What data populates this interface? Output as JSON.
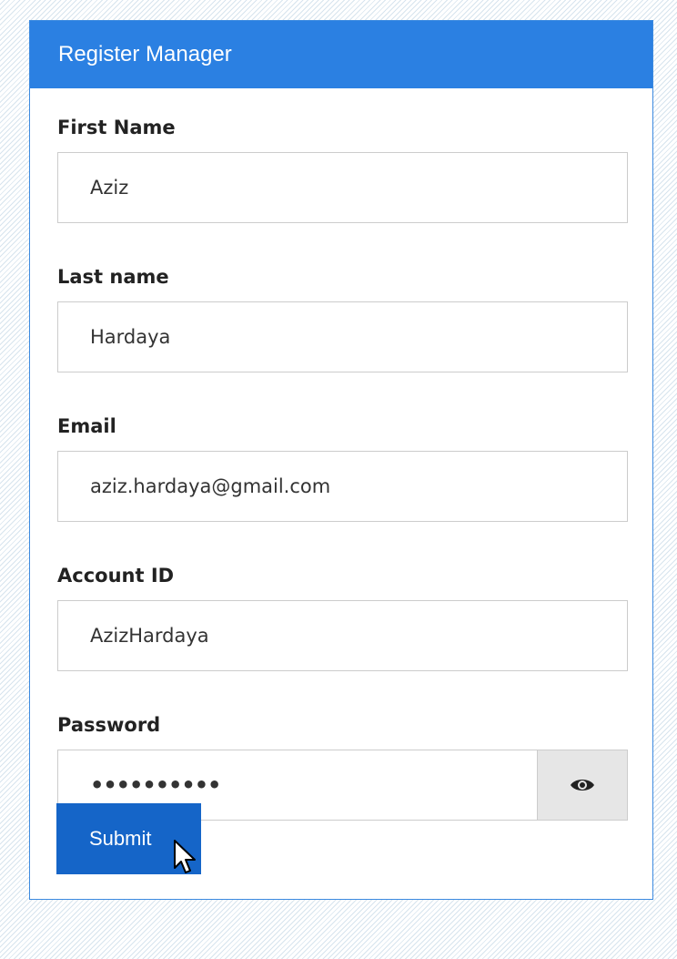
{
  "header": {
    "title": "Register Manager"
  },
  "form": {
    "first_name": {
      "label": "First Name",
      "value": "Aziz"
    },
    "last_name": {
      "label": "Last name",
      "value": "Hardaya"
    },
    "email": {
      "label": "Email",
      "value": "aziz.hardaya@gmail.com"
    },
    "account_id": {
      "label": "Account ID",
      "value": "AzizHardaya"
    },
    "password": {
      "label": "Password",
      "masked_value": "••••••••••",
      "toggle_icon": "eye-icon"
    },
    "submit_label": "Submit"
  },
  "colors": {
    "header_bg": "#2b80e2",
    "submit_bg": "#1565c8",
    "panel_border": "#3c8ae0"
  }
}
